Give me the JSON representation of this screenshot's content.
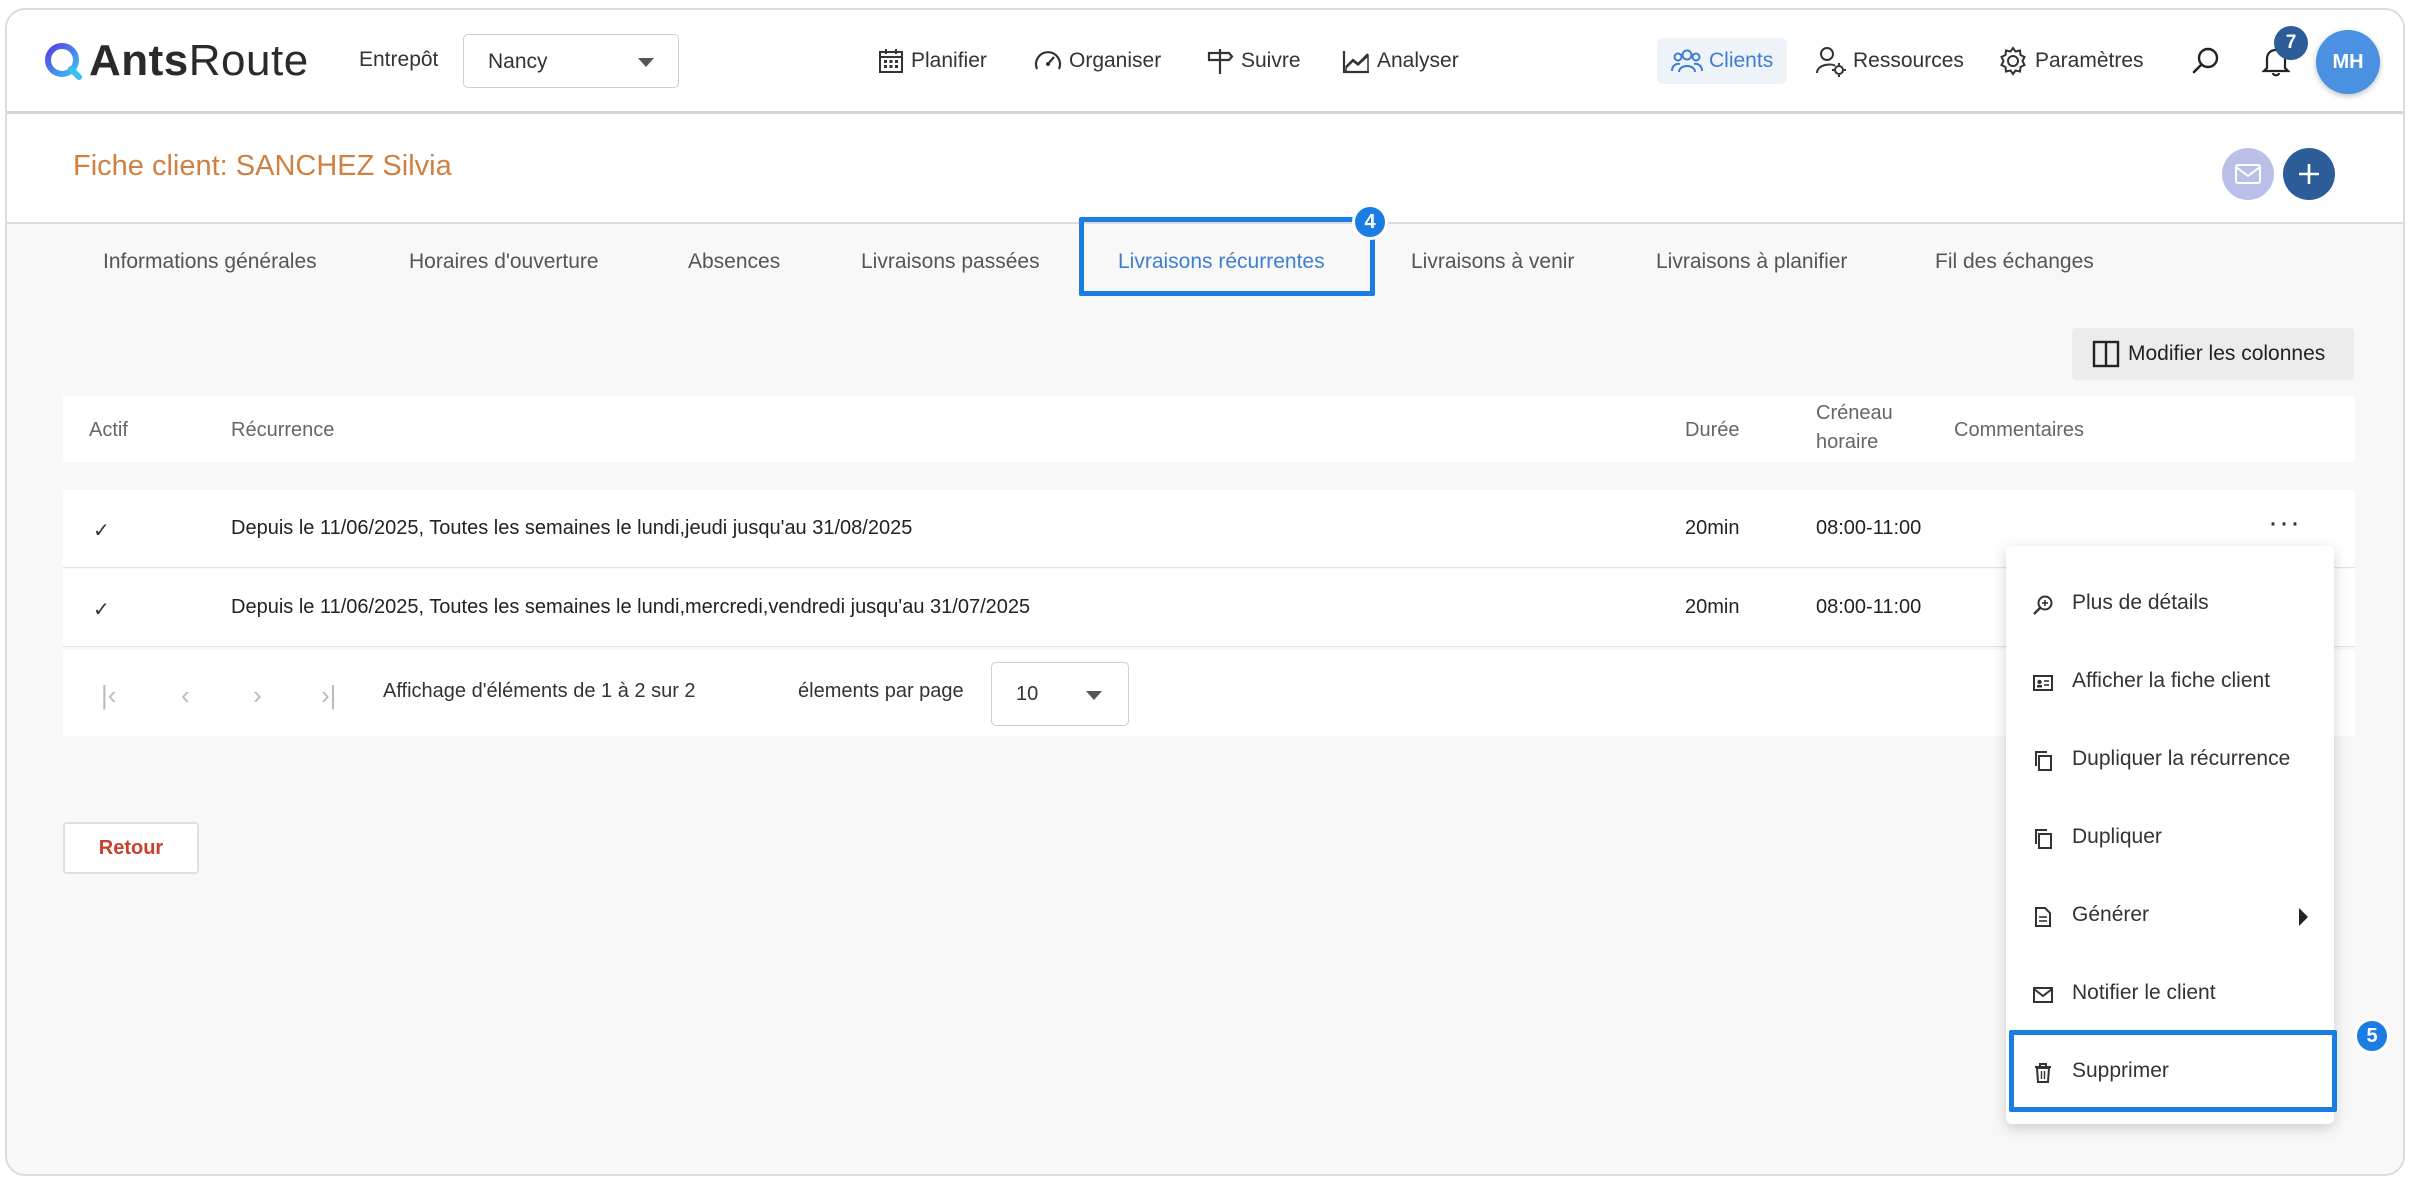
{
  "app": {
    "logo_name_bold": "Ants",
    "logo_name_regular": "Route",
    "warehouse_label": "Entrepôt",
    "warehouse_value": "Nancy",
    "nav": {
      "planifier": "Planifier",
      "organiser": "Organiser",
      "suivre": "Suivre",
      "analyser": "Analyser",
      "clients": "Clients",
      "ressources": "Ressources",
      "parametres": "Paramètres"
    },
    "notifications_count": "7",
    "avatar_initials": "MH",
    "brand_color": "#3e7ed0",
    "accent_color": "#d08141"
  },
  "page": {
    "title": "Fiche client: SANCHEZ Silvia",
    "tabs": [
      {
        "label": "Informations générales"
      },
      {
        "label": "Horaires d'ouverture"
      },
      {
        "label": "Absences"
      },
      {
        "label": "Livraisons passées"
      },
      {
        "label": "Livraisons récurrentes"
      },
      {
        "label": "Livraisons à venir"
      },
      {
        "label": "Livraisons à planifier"
      },
      {
        "label": "Fil des échanges"
      }
    ],
    "active_tab": "Livraisons récurrentes",
    "edit_columns_label": "Modifier les colonnes",
    "back_label": "Retour"
  },
  "table": {
    "headers": {
      "actif": "Actif",
      "recurrence": "Récurrence",
      "duree": "Durée",
      "creneau_line1": "Créneau",
      "creneau_line2": "horaire",
      "commentaires": "Commentaires"
    },
    "rows": [
      {
        "actif": "✓",
        "recurrence": "Depuis le 11/06/2025, Toutes les semaines le lundi,jeudi jusqu'au 31/08/2025",
        "duree": "20min",
        "creneau": "08:00-11:00",
        "commentaires": ""
      },
      {
        "actif": "✓",
        "recurrence": "Depuis le 11/06/2025, Toutes les semaines le lundi,mercredi,vendredi jusqu'au 31/07/2025",
        "duree": "20min",
        "creneau": "08:00-11:00",
        "commentaires": ""
      }
    ],
    "row_actions_label": "···"
  },
  "pagination": {
    "summary": "Affichage d'éléments de 1 à 2 sur 2",
    "per_page_label": "élements par page",
    "per_page_value": "10"
  },
  "context_menu": {
    "items": [
      {
        "label": "Plus de détails",
        "icon": "zoom-icon"
      },
      {
        "label": "Afficher la fiche client",
        "icon": "id-card-icon"
      },
      {
        "label": "Dupliquer la récurrence",
        "icon": "copy-icon"
      },
      {
        "label": "Dupliquer",
        "icon": "copy-icon"
      },
      {
        "label": "Générer",
        "icon": "document-icon"
      },
      {
        "label": "Notifier le client",
        "icon": "mail-icon"
      },
      {
        "label": "Supprimer",
        "icon": "trash-icon"
      }
    ]
  },
  "annotations": {
    "step_tab": "4",
    "step_delete": "5",
    "highlight_color": "#1b7de3"
  }
}
